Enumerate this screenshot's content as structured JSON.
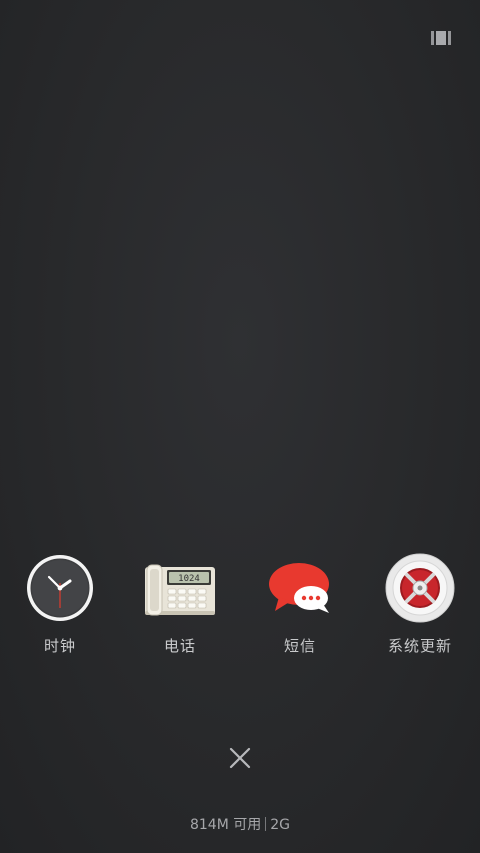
{
  "top_bar": {
    "view_toggle_icon": "grid-view-icon"
  },
  "recent_apps": [
    {
      "label": "时钟",
      "icon": "clock-icon"
    },
    {
      "label": "电话",
      "icon": "desk-phone-icon"
    },
    {
      "label": "短信",
      "icon": "message-bubble-icon"
    },
    {
      "label": "系统更新",
      "icon": "safe-update-icon"
    }
  ],
  "phone_display": "1024",
  "close_icon": "close-icon",
  "memory": {
    "available": "814M 可用",
    "total": "2G"
  },
  "colors": {
    "background": "#2a2b2d",
    "label_text": "#c9cacc",
    "sms_red": "#e8392f",
    "update_red": "#c8262c"
  }
}
